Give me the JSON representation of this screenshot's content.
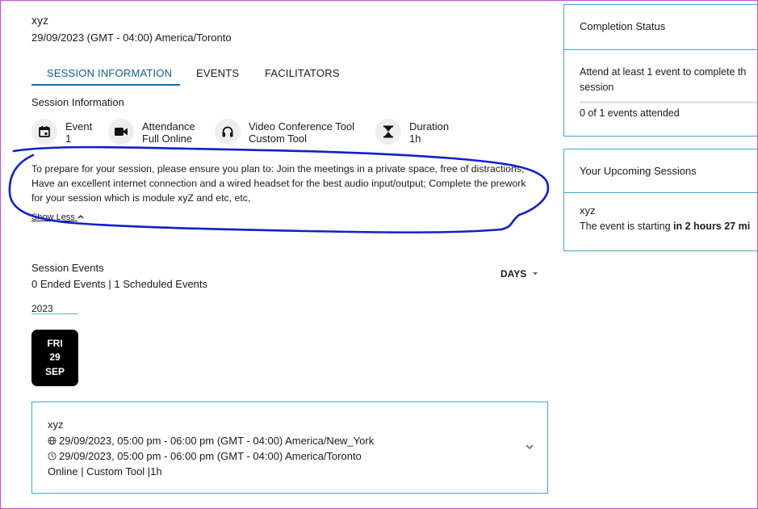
{
  "session": {
    "title": "xyz",
    "date": "29/09/2023 (GMT - 04:00) America/Toronto"
  },
  "tabs": [
    {
      "label": "SESSION INFORMATION",
      "active": true
    },
    {
      "label": "EVENTS",
      "active": false
    },
    {
      "label": "FACILITATORS",
      "active": false
    }
  ],
  "info": {
    "heading": "Session Information",
    "items": [
      {
        "label": "Event",
        "value": "1",
        "icon": "calendar-icon"
      },
      {
        "label": "Attendance",
        "value": "Full Online",
        "icon": "video-camera-icon"
      },
      {
        "label": "Video Conference Tool",
        "value": "Custom Tool",
        "icon": "headphones-icon"
      },
      {
        "label": "Duration",
        "value": "1h",
        "icon": "hourglass-icon"
      }
    ],
    "description": "To prepare for your session, please ensure you plan to: Join the meetings in a private space, free of distractions; Have an excellent internet connection and a wired headset for the best audio input/output; Complete the prework for your session which is module xyZ and etc, etc,",
    "show_less": "Show Less"
  },
  "events": {
    "heading": "Session Events",
    "counts": "0 Ended Events | 1 Scheduled Events",
    "view_mode": "DAYS",
    "year": "2023",
    "badge": {
      "day_name": "FRI",
      "day": "29",
      "month": "SEP"
    },
    "card": {
      "title": "xyz",
      "time_local": "29/09/2023, 05:00 pm - 06:00 pm (GMT - 04:00) America/New_York",
      "time_user": "29/09/2023, 05:00 pm - 06:00 pm (GMT - 04:00) America/Toronto",
      "details": "Online | Custom Tool |1h"
    }
  },
  "completion": {
    "title": "Completion Status",
    "requirement_line1": "Attend at least 1 event to complete th",
    "requirement_line2": "session",
    "progress": "0 of 1 events attended",
    "progress_fraction": 0
  },
  "upcoming": {
    "title": "Your Upcoming Sessions",
    "session_name": "xyz",
    "status_prefix": "The event is starting ",
    "status_bold": "in 2 hours 27 mi"
  },
  "colors": {
    "accent": "#0f6db0",
    "border": "#3ea8c9",
    "annotation": "#1020c8"
  }
}
